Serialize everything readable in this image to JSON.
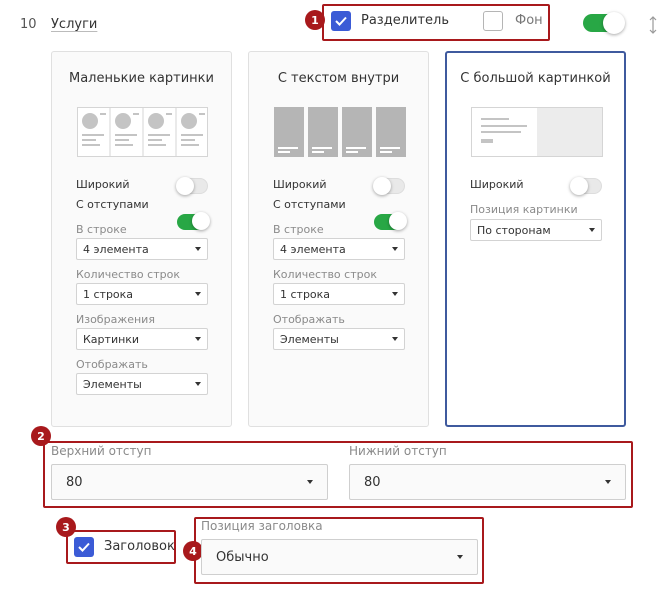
{
  "section": {
    "number": "10",
    "title": "Услуги"
  },
  "top_options": {
    "divider": {
      "label": "Разделитель",
      "checked": true
    },
    "background": {
      "label": "Фон",
      "checked": false
    },
    "enabled": true
  },
  "badges": [
    "1",
    "2",
    "3",
    "4"
  ],
  "cards": [
    {
      "title": "Маленькие картинки",
      "wide_label": "Широкий",
      "wide_on": false,
      "padding_label": "С отступами",
      "padding_on": true,
      "row_label": "В строке",
      "row_value": "4 элемента",
      "rows_label": "Количество строк",
      "rows_value": "1 строка",
      "images_label": "Изображения",
      "images_value": "Картинки",
      "display_label": "Отображать",
      "display_value": "Элементы"
    },
    {
      "title": "С текстом внутри",
      "wide_label": "Широкий",
      "wide_on": false,
      "padding_label": "С отступами",
      "padding_on": true,
      "row_label": "В строке",
      "row_value": "4 элемента",
      "rows_label": "Количество строк",
      "rows_value": "1 строка",
      "display_label": "Отображать",
      "display_value": "Элементы"
    },
    {
      "title": "С большой картинкой",
      "selected": true,
      "wide_label": "Широкий",
      "wide_on": false,
      "position_label": "Позиция картинки",
      "position_value": "По сторонам"
    }
  ],
  "spacing": {
    "top_label": "Верхний отступ",
    "top_value": "80",
    "bottom_label": "Нижний отступ",
    "bottom_value": "80"
  },
  "heading": {
    "label": "Заголовок",
    "checked": true
  },
  "heading_position": {
    "label": "Позиция заголовка",
    "value": "Обычно"
  },
  "colors": {
    "accent": "#3b5bd6",
    "toggle_on": "#28a745",
    "highlight": "#a8191c",
    "selected_border": "#3f5a9e"
  }
}
